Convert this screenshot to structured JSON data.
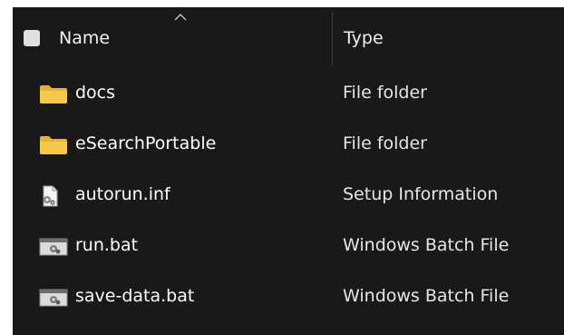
{
  "header": {
    "name_label": "Name",
    "type_label": "Type",
    "sort_indicator_icon": "chevron-up-icon"
  },
  "files": [
    {
      "name": "docs",
      "type": "File folder",
      "icon": "folder-icon"
    },
    {
      "name": "eSearchPortable",
      "type": "File folder",
      "icon": "folder-icon"
    },
    {
      "name": "autorun.inf",
      "type": "Setup Information",
      "icon": "setup-info-file-icon"
    },
    {
      "name": "run.bat",
      "type": "Windows Batch File",
      "icon": "batch-file-icon"
    },
    {
      "name": "save-data.bat",
      "type": "Windows Batch File",
      "icon": "batch-file-icon"
    }
  ],
  "colors": {
    "background": "#191919",
    "text": "#ffffff",
    "folder": "#f8c948"
  }
}
